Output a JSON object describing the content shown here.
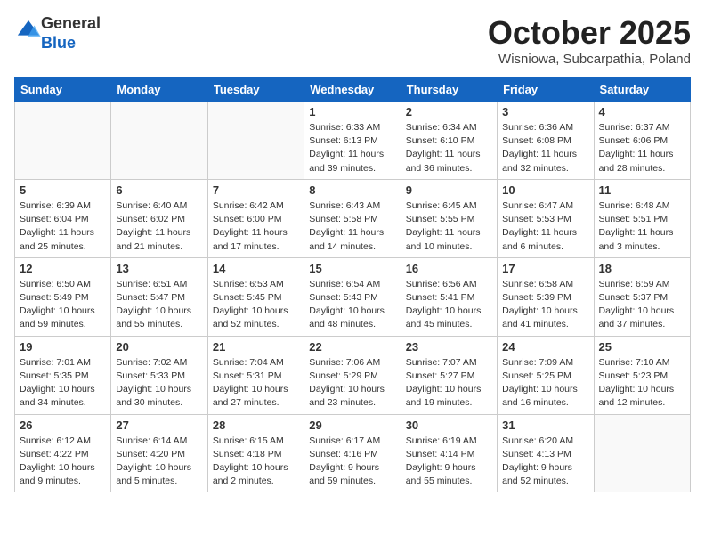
{
  "header": {
    "logo_line1": "General",
    "logo_line2": "Blue",
    "month": "October 2025",
    "location": "Wisniowa, Subcarpathia, Poland"
  },
  "weekdays": [
    "Sunday",
    "Monday",
    "Tuesday",
    "Wednesday",
    "Thursday",
    "Friday",
    "Saturday"
  ],
  "weeks": [
    [
      {
        "day": "",
        "info": ""
      },
      {
        "day": "",
        "info": ""
      },
      {
        "day": "",
        "info": ""
      },
      {
        "day": "1",
        "info": "Sunrise: 6:33 AM\nSunset: 6:13 PM\nDaylight: 11 hours\nand 39 minutes."
      },
      {
        "day": "2",
        "info": "Sunrise: 6:34 AM\nSunset: 6:10 PM\nDaylight: 11 hours\nand 36 minutes."
      },
      {
        "day": "3",
        "info": "Sunrise: 6:36 AM\nSunset: 6:08 PM\nDaylight: 11 hours\nand 32 minutes."
      },
      {
        "day": "4",
        "info": "Sunrise: 6:37 AM\nSunset: 6:06 PM\nDaylight: 11 hours\nand 28 minutes."
      }
    ],
    [
      {
        "day": "5",
        "info": "Sunrise: 6:39 AM\nSunset: 6:04 PM\nDaylight: 11 hours\nand 25 minutes."
      },
      {
        "day": "6",
        "info": "Sunrise: 6:40 AM\nSunset: 6:02 PM\nDaylight: 11 hours\nand 21 minutes."
      },
      {
        "day": "7",
        "info": "Sunrise: 6:42 AM\nSunset: 6:00 PM\nDaylight: 11 hours\nand 17 minutes."
      },
      {
        "day": "8",
        "info": "Sunrise: 6:43 AM\nSunset: 5:58 PM\nDaylight: 11 hours\nand 14 minutes."
      },
      {
        "day": "9",
        "info": "Sunrise: 6:45 AM\nSunset: 5:55 PM\nDaylight: 11 hours\nand 10 minutes."
      },
      {
        "day": "10",
        "info": "Sunrise: 6:47 AM\nSunset: 5:53 PM\nDaylight: 11 hours\nand 6 minutes."
      },
      {
        "day": "11",
        "info": "Sunrise: 6:48 AM\nSunset: 5:51 PM\nDaylight: 11 hours\nand 3 minutes."
      }
    ],
    [
      {
        "day": "12",
        "info": "Sunrise: 6:50 AM\nSunset: 5:49 PM\nDaylight: 10 hours\nand 59 minutes."
      },
      {
        "day": "13",
        "info": "Sunrise: 6:51 AM\nSunset: 5:47 PM\nDaylight: 10 hours\nand 55 minutes."
      },
      {
        "day": "14",
        "info": "Sunrise: 6:53 AM\nSunset: 5:45 PM\nDaylight: 10 hours\nand 52 minutes."
      },
      {
        "day": "15",
        "info": "Sunrise: 6:54 AM\nSunset: 5:43 PM\nDaylight: 10 hours\nand 48 minutes."
      },
      {
        "day": "16",
        "info": "Sunrise: 6:56 AM\nSunset: 5:41 PM\nDaylight: 10 hours\nand 45 minutes."
      },
      {
        "day": "17",
        "info": "Sunrise: 6:58 AM\nSunset: 5:39 PM\nDaylight: 10 hours\nand 41 minutes."
      },
      {
        "day": "18",
        "info": "Sunrise: 6:59 AM\nSunset: 5:37 PM\nDaylight: 10 hours\nand 37 minutes."
      }
    ],
    [
      {
        "day": "19",
        "info": "Sunrise: 7:01 AM\nSunset: 5:35 PM\nDaylight: 10 hours\nand 34 minutes."
      },
      {
        "day": "20",
        "info": "Sunrise: 7:02 AM\nSunset: 5:33 PM\nDaylight: 10 hours\nand 30 minutes."
      },
      {
        "day": "21",
        "info": "Sunrise: 7:04 AM\nSunset: 5:31 PM\nDaylight: 10 hours\nand 27 minutes."
      },
      {
        "day": "22",
        "info": "Sunrise: 7:06 AM\nSunset: 5:29 PM\nDaylight: 10 hours\nand 23 minutes."
      },
      {
        "day": "23",
        "info": "Sunrise: 7:07 AM\nSunset: 5:27 PM\nDaylight: 10 hours\nand 19 minutes."
      },
      {
        "day": "24",
        "info": "Sunrise: 7:09 AM\nSunset: 5:25 PM\nDaylight: 10 hours\nand 16 minutes."
      },
      {
        "day": "25",
        "info": "Sunrise: 7:10 AM\nSunset: 5:23 PM\nDaylight: 10 hours\nand 12 minutes."
      }
    ],
    [
      {
        "day": "26",
        "info": "Sunrise: 6:12 AM\nSunset: 4:22 PM\nDaylight: 10 hours\nand 9 minutes."
      },
      {
        "day": "27",
        "info": "Sunrise: 6:14 AM\nSunset: 4:20 PM\nDaylight: 10 hours\nand 5 minutes."
      },
      {
        "day": "28",
        "info": "Sunrise: 6:15 AM\nSunset: 4:18 PM\nDaylight: 10 hours\nand 2 minutes."
      },
      {
        "day": "29",
        "info": "Sunrise: 6:17 AM\nSunset: 4:16 PM\nDaylight: 9 hours\nand 59 minutes."
      },
      {
        "day": "30",
        "info": "Sunrise: 6:19 AM\nSunset: 4:14 PM\nDaylight: 9 hours\nand 55 minutes."
      },
      {
        "day": "31",
        "info": "Sunrise: 6:20 AM\nSunset: 4:13 PM\nDaylight: 9 hours\nand 52 minutes."
      },
      {
        "day": "",
        "info": ""
      }
    ]
  ]
}
